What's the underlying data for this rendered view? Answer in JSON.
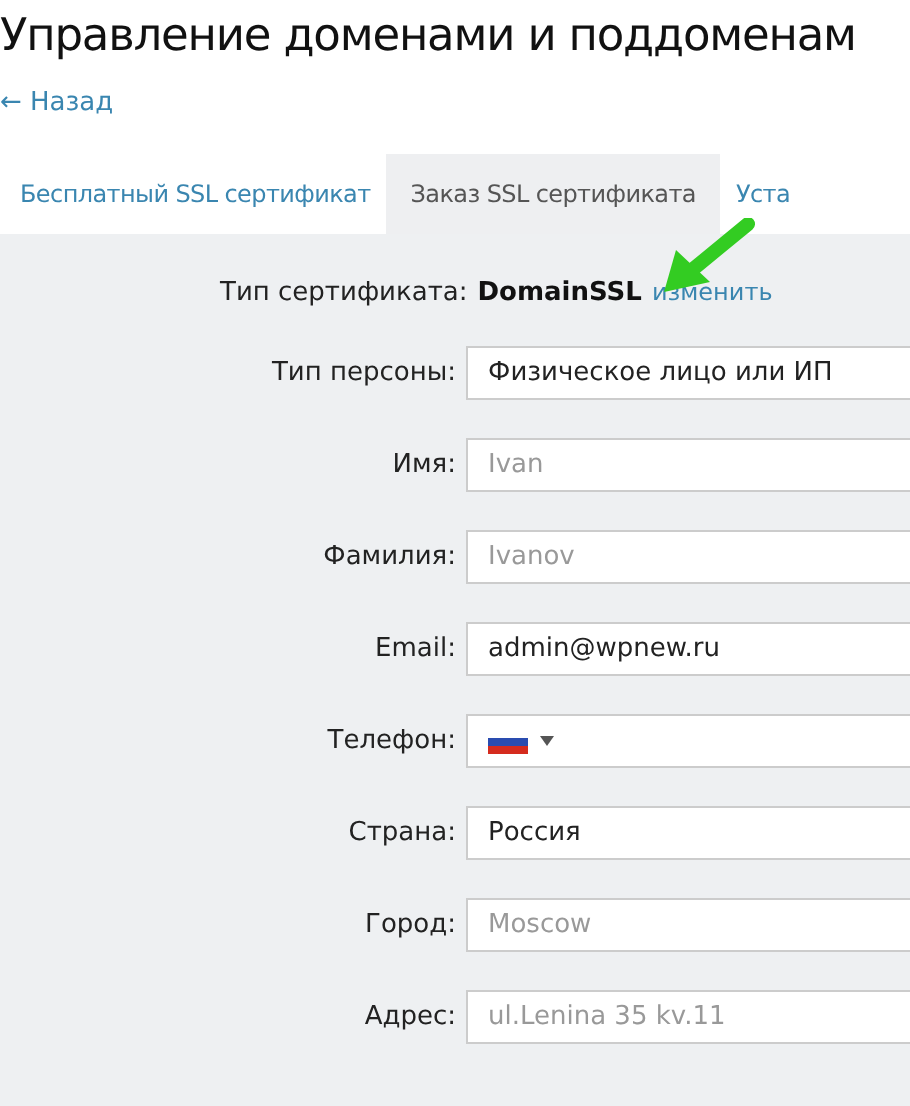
{
  "page": {
    "title": "Управление доменами и поддоменам",
    "back_link": "← Назад"
  },
  "tabs": [
    {
      "label": "Бесплатный SSL сертификат",
      "selected": false
    },
    {
      "label": "Заказ SSL сертификата",
      "selected": true
    },
    {
      "label": "Уста",
      "selected": false
    }
  ],
  "certificate": {
    "label": "Тип сертификата:",
    "value": "DomainSSL",
    "change_link": "изменить"
  },
  "fields": [
    {
      "kind": "select",
      "label": "Тип персоны:",
      "value": "Физическое лицо или ИП"
    },
    {
      "kind": "text",
      "label": "Имя:",
      "placeholder": "Ivan"
    },
    {
      "kind": "text",
      "label": "Фамилия:",
      "placeholder": "Ivanov"
    },
    {
      "kind": "text",
      "label": "Email:",
      "value": "admin@wpnew.ru"
    },
    {
      "kind": "phone",
      "label": "Телефон:"
    },
    {
      "kind": "select",
      "label": "Страна:",
      "value": "Россия"
    },
    {
      "kind": "text",
      "label": "Город:",
      "placeholder": "Moscow"
    },
    {
      "kind": "text",
      "label": "Адрес:",
      "placeholder": "ul.Lenina 35 kv.11"
    }
  ]
}
